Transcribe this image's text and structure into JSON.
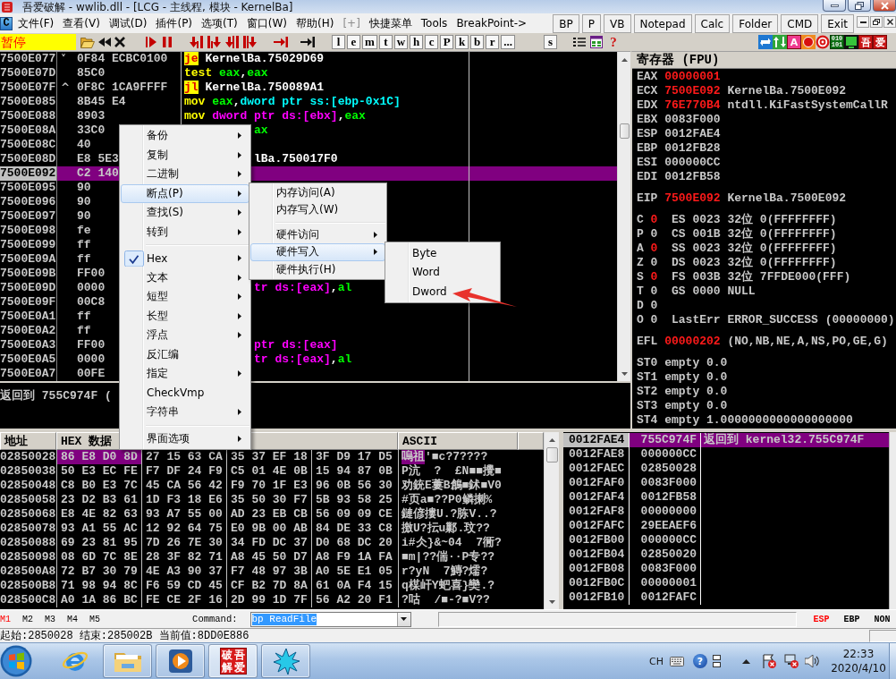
{
  "window": {
    "title": "吾爱破解 - wwlib.dll - [LCG - 主线程, 模块 - KernelBa]"
  },
  "menu_bar": {
    "child_icon": "C",
    "items": [
      {
        "label": "文件(F)",
        "disabled": false
      },
      {
        "label": "查看(V)",
        "disabled": false
      },
      {
        "label": "调试(D)",
        "disabled": false
      },
      {
        "label": "插件(P)",
        "disabled": false
      },
      {
        "label": "选项(T)",
        "disabled": false
      },
      {
        "label": "窗口(W)",
        "disabled": false
      },
      {
        "label": "帮助(H)",
        "disabled": false
      },
      {
        "label": "[+]",
        "disabled": true
      },
      {
        "label": "快捷菜单",
        "disabled": false
      },
      {
        "label": "Tools",
        "disabled": false
      },
      {
        "label": "BreakPoint->",
        "disabled": false
      }
    ],
    "quick_buttons": [
      "BP",
      "P",
      "VB",
      "Notepad",
      "Calc",
      "Folder",
      "CMD",
      "Exit"
    ]
  },
  "toolbar": {
    "status": "暂停",
    "letter_buttons": [
      "l",
      "e",
      "m",
      "t",
      "w",
      "h",
      "c",
      "P",
      "k",
      "b",
      "r",
      "..."
    ],
    "extra_buttons": [
      "s"
    ],
    "help": "?",
    "plugin_letters": [
      "A",
      "吾",
      "爱"
    ],
    "binary_tile": "010 101"
  },
  "disassembly": {
    "rows": [
      {
        "address": "7500E077",
        "jump_mark": "˅",
        "hex": "0F84 ECBC0100",
        "selected": false,
        "code": [
          {
            "kind": "jump",
            "text": "je"
          },
          {
            "kind": "label",
            "text": " KernelBa.75029D69"
          }
        ]
      },
      {
        "address": "7500E07D",
        "hex": "85C0",
        "selected": false,
        "code": [
          {
            "kind": "mnemonic",
            "text": "test"
          },
          {
            "kind": "register",
            "text": " eax"
          },
          {
            "kind": "plain",
            "text": ","
          },
          {
            "kind": "register",
            "text": "eax"
          }
        ]
      },
      {
        "address": "7500E07F",
        "jump_mark": "^",
        "hex": "0F8C 1CA9FFFF",
        "selected": false,
        "code": [
          {
            "kind": "jump",
            "text": "jl"
          },
          {
            "kind": "label",
            "text": " KernelBa.750089A1"
          }
        ]
      },
      {
        "address": "7500E085",
        "hex": "8B45 E4",
        "selected": false,
        "code": [
          {
            "kind": "mnemonic",
            "text": "mov"
          },
          {
            "kind": "register",
            "text": " eax"
          },
          {
            "kind": "plain",
            "text": ","
          },
          {
            "kind": "stack_memory",
            "text": "dword ptr ss:[ebp-0x1C]"
          }
        ]
      },
      {
        "address": "7500E088",
        "hex": "8903",
        "selected": false,
        "code": [
          {
            "kind": "mnemonic",
            "text": "mov"
          },
          {
            "kind": "data_memory",
            "text": " dword ptr ds:[ebx]"
          },
          {
            "kind": "plain",
            "text": ","
          },
          {
            "kind": "register",
            "text": "eax"
          }
        ]
      },
      {
        "address": "7500E08A",
        "hex": "33C0",
        "selected": false,
        "code_tail": [
          {
            "kind": "register",
            "text": "ax"
          }
        ]
      },
      {
        "address": "7500E08C",
        "hex": "40",
        "selected": false
      },
      {
        "address": "7500E08D",
        "hex": "E8 5E3",
        "selected": false,
        "code_tail": [
          {
            "kind": "label",
            "text": "lBa.750017F0"
          }
        ]
      },
      {
        "address": "7500E092",
        "hex": "C2 140",
        "selected": true
      },
      {
        "address": "7500E095",
        "hex": "90",
        "selected": false
      },
      {
        "address": "7500E096",
        "hex": "90",
        "selected": false
      },
      {
        "address": "7500E097",
        "hex": "90",
        "selected": false
      },
      {
        "address": "7500E098",
        "hex": "fe",
        "selected": false
      },
      {
        "address": "7500E099",
        "hex": "ff",
        "selected": false
      },
      {
        "address": "7500E09A",
        "hex": "ff",
        "selected": false
      },
      {
        "address": "7500E09B",
        "hex": "FF00",
        "selected": false
      },
      {
        "address": "7500E09D",
        "hex": "0000",
        "selected": false,
        "code_tail": [
          {
            "kind": "data_memory",
            "text": "tr ds:[eax]"
          },
          {
            "kind": "plain",
            "text": ","
          },
          {
            "kind": "register",
            "text": "al"
          }
        ]
      },
      {
        "address": "7500E09F",
        "hex": "00C8",
        "selected": false
      },
      {
        "address": "7500E0A1",
        "hex": "ff",
        "selected": false
      },
      {
        "address": "7500E0A2",
        "hex": "ff",
        "selected": false
      },
      {
        "address": "7500E0A3",
        "hex": "FF00",
        "selected": false,
        "code_tail": [
          {
            "kind": "data_memory",
            "text": "ptr ds:[eax]"
          }
        ]
      },
      {
        "address": "7500E0A5",
        "hex": "0000",
        "selected": false,
        "code_tail": [
          {
            "kind": "data_memory",
            "text": "tr ds:[eax]"
          },
          {
            "kind": "plain",
            "text": ","
          },
          {
            "kind": "register",
            "text": "al"
          }
        ]
      },
      {
        "address": "7500E0A7",
        "hex": "00FE",
        "selected": false
      }
    ]
  },
  "info": {
    "text": "返回到 755C974F ("
  },
  "registers": {
    "title": "寄存器 (FPU)",
    "general": [
      {
        "name": "EAX",
        "value": "00000001",
        "changed": true
      },
      {
        "name": "ECX",
        "value": "7500E092",
        "changed": true,
        "comment": "KernelBa.7500E092"
      },
      {
        "name": "EDX",
        "value": "76E770B4",
        "changed": true,
        "comment": "ntdll.KiFastSystemCallR"
      },
      {
        "name": "EBX",
        "value": "0083F000",
        "changed": false
      },
      {
        "name": "ESP",
        "value": "0012FAE4",
        "changed": false
      },
      {
        "name": "EBP",
        "value": "0012FB28",
        "changed": false
      },
      {
        "name": "ESI",
        "value": "000000CC",
        "changed": false
      },
      {
        "name": "EDI",
        "value": "0012FB58",
        "changed": false
      }
    ],
    "eip": {
      "name": "EIP",
      "value": "7500E092",
      "changed": true,
      "comment": "KernelBa.7500E092"
    },
    "flags": [
      {
        "name": "C",
        "value": "0",
        "changed": true,
        "segment": "ES 0023 32位 0(FFFFFFFF)"
      },
      {
        "name": "P",
        "value": "0",
        "changed": false,
        "segment": "CS 001B 32位 0(FFFFFFFF)"
      },
      {
        "name": "A",
        "value": "0",
        "changed": true,
        "segment": "SS 0023 32位 0(FFFFFFFF)"
      },
      {
        "name": "Z",
        "value": "0",
        "changed": false,
        "segment": "DS 0023 32位 0(FFFFFFFF)"
      },
      {
        "name": "S",
        "value": "0",
        "changed": true,
        "segment": "FS 003B 32位 7FFDE000(FFF)"
      },
      {
        "name": "T",
        "value": "0",
        "changed": false,
        "segment": "GS 0000 NULL"
      },
      {
        "name": "D",
        "value": "0",
        "changed": false
      },
      {
        "name": "O",
        "value": "0",
        "changed": false,
        "segment": "LastErr ERROR_SUCCESS (00000000)"
      }
    ],
    "efl": {
      "name": "EFL",
      "value": "00000202",
      "changed": true,
      "comment": "(NO,NB,NE,A,NS,PO,GE,G)"
    },
    "fpu": [
      {
        "name": "ST0",
        "tag": "empty",
        "value": "0.0"
      },
      {
        "name": "ST1",
        "tag": "empty",
        "value": "0.0"
      },
      {
        "name": "ST2",
        "tag": "empty",
        "value": "0.0"
      },
      {
        "name": "ST3",
        "tag": "empty",
        "value": "0.0"
      },
      {
        "name": "ST4",
        "tag": "empty",
        "value": "1.0000000000000000000"
      }
    ]
  },
  "dump": {
    "columns": [
      "地址",
      "HEX 数据",
      "ASCII"
    ],
    "rows": [
      {
        "address": "02850028",
        "hex": [
          {
            "text": "86 E8 D0 8D",
            "selected": true
          },
          {
            "text": "27 15 63 CA",
            "selected": false
          },
          {
            "text": "35 37 EF 18",
            "selected": false
          },
          {
            "text": "3F D9 17 D5",
            "selected": false
          }
        ],
        "ascii": [
          {
            "text": "嗚祖",
            "selected": true
          },
          {
            "text": "'■c?7????",
            "selected": false
          }
        ]
      },
      {
        "address": "02850038",
        "hex": [
          {
            "text": "50 E3 EC FE",
            "selected": false
          },
          {
            "text": "F7 DF 24 F9",
            "selected": false
          },
          {
            "text": "C5 01 4E 0B",
            "selected": false
          },
          {
            "text": "15 94 87 0B",
            "selected": false
          }
        ],
        "ascii": [
          {
            "text": "P沆  ?  £N■■攪■",
            "selected": false
          }
        ]
      },
      {
        "address": "02850048",
        "hex": [
          {
            "text": "C8 B0 E3 7C",
            "selected": false
          },
          {
            "text": "45 CA 56 42",
            "selected": false
          },
          {
            "text": "F9 70 1F E3",
            "selected": false
          },
          {
            "text": "96 0B 56 30",
            "selected": false
          }
        ],
        "ascii": [
          {
            "text": "劝銃E蔞B鶬■鉥■V0",
            "selected": false
          }
        ]
      },
      {
        "address": "02850058",
        "hex": [
          {
            "text": "23 D2 B3 61",
            "selected": false
          },
          {
            "text": "1D F3 18 E6",
            "selected": false
          },
          {
            "text": "35 50 30 F7",
            "selected": false
          },
          {
            "text": "5B 93 58 25",
            "selected": false
          }
        ],
        "ascii": [
          {
            "text": "#页a■??P0鳞揦%",
            "selected": false
          }
        ]
      },
      {
        "address": "02850068",
        "hex": [
          {
            "text": "E8 4E 82 63",
            "selected": false
          },
          {
            "text": "93 A7 55 00",
            "selected": false
          },
          {
            "text": "AD 23 EB CB",
            "selected": false
          },
          {
            "text": "56 09 09 CE",
            "selected": false
          }
        ],
        "ascii": [
          {
            "text": "鏈偐摟U.?胨V..?",
            "selected": false
          }
        ]
      },
      {
        "address": "02850078",
        "hex": [
          {
            "text": "93 A1 55 AC",
            "selected": false
          },
          {
            "text": "12 92 64 75",
            "selected": false
          },
          {
            "text": "E0 9B 00 AB",
            "selected": false
          },
          {
            "text": "84 DE 33 C8",
            "selected": false
          }
        ],
        "ascii": [
          {
            "text": "撽U?抎u鄛.玟??",
            "selected": false
          }
        ]
      },
      {
        "address": "02850088",
        "hex": [
          {
            "text": "69 23 81 95",
            "selected": false
          },
          {
            "text": "7D 26 7E 30",
            "selected": false
          },
          {
            "text": "34 FD DC 37",
            "selected": false
          },
          {
            "text": "D0 68 DC 20",
            "selected": false
          }
        ],
        "ascii": [
          {
            "text": "i#仌}&~04  7衕?",
            "selected": false
          }
        ]
      },
      {
        "address": "02850098",
        "hex": [
          {
            "text": "08 6D 7C 8E",
            "selected": false
          },
          {
            "text": "28 3F 82 71",
            "selected": false
          },
          {
            "text": "A8 45 50 D7",
            "selected": false
          },
          {
            "text": "A8 F9 1A FA",
            "selected": false
          }
        ],
        "ascii": [
          {
            "text": "■m|??偳··P专??",
            "selected": false
          }
        ]
      },
      {
        "address": "028500A8",
        "hex": [
          {
            "text": "72 B7 30 79",
            "selected": false
          },
          {
            "text": "4E A3 90 37",
            "selected": false
          },
          {
            "text": "F7 48 97 3B",
            "selected": false
          },
          {
            "text": "A0 5E E1 05",
            "selected": false
          }
        ],
        "ascii": [
          {
            "text": "r?yN  7鱄?燸?",
            "selected": false
          }
        ]
      },
      {
        "address": "028500B8",
        "hex": [
          {
            "text": "71 98 94 8C",
            "selected": false
          },
          {
            "text": "F6 59 CD 45",
            "selected": false
          },
          {
            "text": "CF B2 7D 8A",
            "selected": false
          },
          {
            "text": "61 0A F4 15",
            "selected": false
          }
        ],
        "ascii": [
          {
            "text": "q楳屽Y蚆喜}奱.?",
            "selected": false
          }
        ]
      },
      {
        "address": "028500C8",
        "hex": [
          {
            "text": "A0 1A 86 BC",
            "selected": false
          },
          {
            "text": "FE CE 2F 16",
            "selected": false
          },
          {
            "text": "2D 99 1D 7F",
            "selected": false
          },
          {
            "text": "56 A2 20 F1",
            "selected": false
          }
        ],
        "ascii": [
          {
            "text": "?咕  /■-?■V??",
            "selected": false
          }
        ]
      }
    ]
  },
  "stack": {
    "rows": [
      {
        "address": "0012FAE4",
        "value": "755C974F",
        "comment": "返回到 kernel32.755C974F",
        "selected": true
      },
      {
        "address": "0012FAE8",
        "value": "000000CC",
        "selected": false
      },
      {
        "address": "0012FAEC",
        "value": "02850028",
        "selected": false
      },
      {
        "address": "0012FAF0",
        "value": "0083F000",
        "selected": false
      },
      {
        "address": "0012FAF4",
        "value": "0012FB58",
        "selected": false
      },
      {
        "address": "0012FAF8",
        "value": "00000000",
        "selected": false
      },
      {
        "address": "0012FAFC",
        "value": "29EEAEF6",
        "selected": false
      },
      {
        "address": "0012FB00",
        "value": "000000CC",
        "selected": false
      },
      {
        "address": "0012FB04",
        "value": "02850020",
        "selected": false
      },
      {
        "address": "0012FB08",
        "value": "0083F000",
        "selected": false
      },
      {
        "address": "0012FB0C",
        "value": "00000001",
        "selected": false
      },
      {
        "address": "0012FB10",
        "value": "0012FAFC",
        "selected": false
      }
    ]
  },
  "command_bar": {
    "bookmarks": [
      {
        "label": "M1",
        "active": true
      },
      {
        "label": "M2",
        "active": false
      },
      {
        "label": "M3",
        "active": false
      },
      {
        "label": "M4",
        "active": false
      },
      {
        "label": "M5",
        "active": false
      }
    ],
    "label": "Command:",
    "value": "bp ReadFile",
    "value_selected": true,
    "register_buttons": [
      {
        "label": "ESP",
        "active": true
      },
      {
        "label": "EBP",
        "active": false
      },
      {
        "label": "NON",
        "active": false
      }
    ]
  },
  "status_bar": {
    "text": "起始:2850028 结束:285002B 当前值:8DD0E886"
  },
  "taskbar": {
    "buttons": [
      {
        "running": false,
        "active": false
      },
      {
        "running": true,
        "active": false
      },
      {
        "running": true,
        "active": false
      },
      {
        "running": true,
        "active": true,
        "logo": [
          "破",
          "吾",
          "解",
          "爱"
        ]
      },
      {
        "running": true,
        "active": false
      }
    ],
    "tray": {
      "language": "CH",
      "help": "?",
      "time": "22:33",
      "date": "2020/4/10"
    }
  },
  "context_menu": {
    "groups": [
      [
        {
          "label": "备份",
          "submenu": true,
          "checked": false,
          "selected": false
        },
        {
          "label": "复制",
          "submenu": true,
          "checked": false,
          "selected": false
        },
        {
          "label": "二进制",
          "submenu": true,
          "checked": false,
          "selected": false
        },
        {
          "label": "断点(P)",
          "submenu": true,
          "checked": false,
          "selected": true
        },
        {
          "label": "查找(S)",
          "submenu": true,
          "checked": false,
          "selected": false
        },
        {
          "label": "转到",
          "submenu": true,
          "checked": false,
          "selected": false
        }
      ],
      [
        {
          "label": "Hex",
          "submenu": true,
          "checked": true,
          "selected": false
        },
        {
          "label": "文本",
          "submenu": true,
          "checked": false,
          "selected": false
        },
        {
          "label": "短型",
          "submenu": true,
          "checked": false,
          "selected": false
        },
        {
          "label": "长型",
          "submenu": true,
          "checked": false,
          "selected": false
        },
        {
          "label": "浮点",
          "submenu": true,
          "checked": false,
          "selected": false
        },
        {
          "label": "反汇编",
          "submenu": false,
          "checked": false,
          "selected": false
        },
        {
          "label": "指定",
          "submenu": true,
          "checked": false,
          "selected": false
        },
        {
          "label": "CheckVmp",
          "submenu": false,
          "checked": false,
          "selected": false
        },
        {
          "label": "字符串",
          "submenu": true,
          "checked": false,
          "selected": false
        }
      ],
      [
        {
          "label": "界面选项",
          "submenu": true,
          "checked": false,
          "selected": false
        }
      ]
    ]
  },
  "breakpoint_submenu": {
    "groups": [
      [
        {
          "label": "内存访问(A)",
          "submenu": false,
          "selected": false
        },
        {
          "label": "内存写入(W)",
          "submenu": false,
          "selected": false
        }
      ],
      [
        {
          "label": "硬件访问",
          "submenu": true,
          "selected": false
        },
        {
          "label": "硬件写入",
          "submenu": true,
          "selected": true
        },
        {
          "label": "硬件执行(H)",
          "submenu": false,
          "selected": false
        }
      ]
    ]
  },
  "hardware_write_submenu": {
    "groups": [
      [
        {
          "label": "Byte",
          "submenu": false,
          "selected": false
        },
        {
          "label": "Word",
          "submenu": false,
          "selected": false
        },
        {
          "label": "Dword",
          "submenu": false,
          "selected": false
        }
      ]
    ]
  }
}
